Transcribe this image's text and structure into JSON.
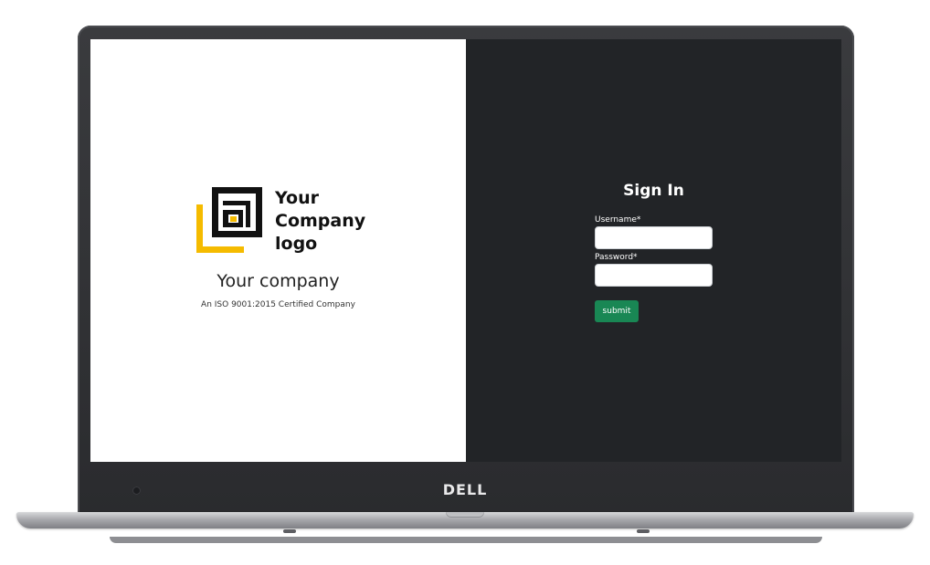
{
  "device": {
    "brand_logo_text": "DELL",
    "icons": [
      "webcam-icon",
      "dell-logo"
    ]
  },
  "colors": {
    "left_panel_bg": "#ffffff",
    "right_panel_bg": "#222427",
    "submit_bg": "#198754",
    "logo_accent": "#f5bb00",
    "logo_dark": "#111111"
  },
  "company": {
    "logo_lines": [
      "Your",
      "Company",
      "logo"
    ],
    "name": "Your company",
    "tagline": "An ISO 9001:2015 Certified Company"
  },
  "signin": {
    "title": "Sign In",
    "username_label": "Username*",
    "username_value": "",
    "password_label": "Password*",
    "password_value": "",
    "submit_label": "submit"
  }
}
